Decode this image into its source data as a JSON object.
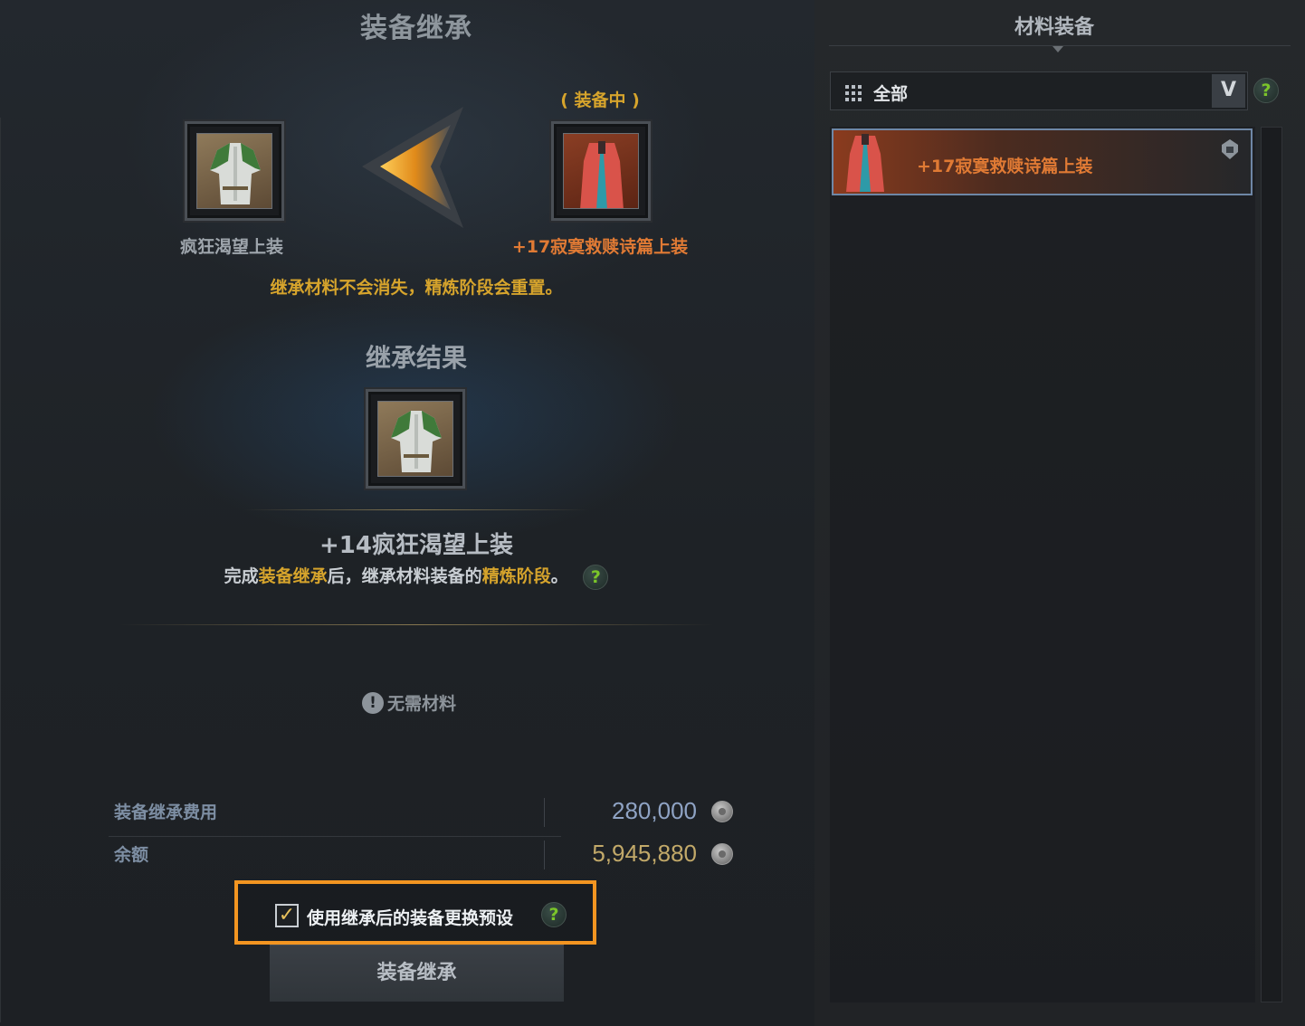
{
  "left": {
    "title": "装备继承",
    "equipped_tag": "( 装备中 )",
    "source_item": {
      "name": "疯狂渴望上装",
      "color": "#9ea5ac"
    },
    "target_item": {
      "name": "+17寂寞救赎诗篇上装",
      "color": "#e07a34"
    },
    "notice": "继承材料不会消失，精炼阶段会重置。",
    "result": {
      "title": "继承结果",
      "item_name": "+14疯狂渴望上装",
      "desc_part1": "完成",
      "desc_hl1": "装备继承",
      "desc_part2": "后，继承材料装备的",
      "desc_hl2": "精炼阶段",
      "desc_part3": "。",
      "help_icon": "?"
    },
    "no_material": {
      "icon": "!",
      "label": "无需材料"
    },
    "costs": [
      {
        "label": "装备继承费用",
        "value": "280,000",
        "color": "#8fa3c4",
        "icon": "silver-coin-icon"
      },
      {
        "label": "余额",
        "value": "5,945,880",
        "color": "#c2a969",
        "icon": "silver-coin-icon"
      }
    ],
    "preset": {
      "checked": true,
      "check_glyph": "✓",
      "label": "使用继承后的装备更换预设",
      "help_icon": "?"
    },
    "inherit_button": "装备继承"
  },
  "right": {
    "title": "材料装备",
    "filter": {
      "label": "全部",
      "dropdown_icon": "chevron-down-icon",
      "dropdown_glyph": "V",
      "help_icon": "?"
    },
    "items": [
      {
        "name": "+17寂寞救赎诗篇上装",
        "color": "#e07a34",
        "selected": true,
        "icon": "locked-helmet-icon"
      }
    ]
  },
  "colors": {
    "accent_gold": "#d6a42c",
    "highlight_orange": "#f39521",
    "help_green": "#7bc52a"
  }
}
